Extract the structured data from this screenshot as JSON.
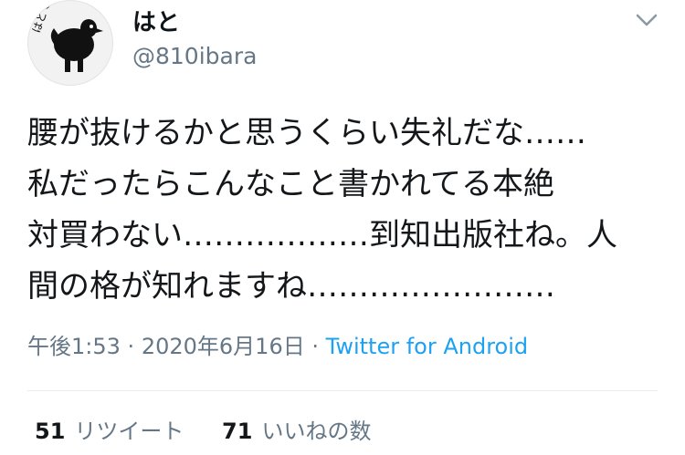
{
  "user": {
    "display_name": "はと",
    "handle": "@810ibara",
    "avatar_text": "はとです"
  },
  "tweet": {
    "text": "腰が抜けるかと思うくらい失礼だな……\n私だったらこんなこと書かれてる本絶\n対買わない………………到知出版社ね。人\n間の格が知れますね……………………"
  },
  "meta": {
    "time": "午後1:53",
    "separator": "·",
    "date": "2020年6月16日",
    "source": "Twitter for Android"
  },
  "stats": {
    "retweets_count": "51",
    "retweets_label": "リツイート",
    "likes_count": "71",
    "likes_label": "いいねの数"
  },
  "colors": {
    "secondary_text": "#657786",
    "link": "#1da1f2"
  },
  "icons": {
    "menu": "chevron-down-icon"
  }
}
